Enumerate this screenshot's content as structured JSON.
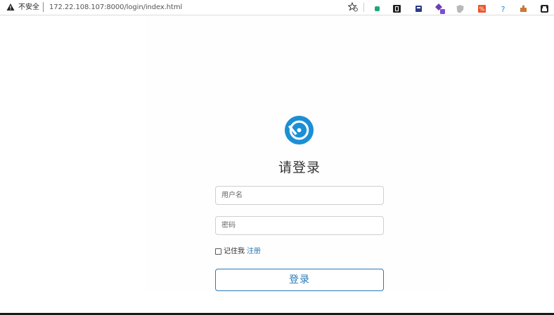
{
  "browser": {
    "security_label": "不安全",
    "url": "172.22.108.107:8000/login/index.html",
    "extension_icons": [
      {
        "name": "ext-green-icon",
        "color": "#1aa87a"
      },
      {
        "name": "ext-black-icon",
        "color": "#222222"
      },
      {
        "name": "ext-navy-icon",
        "color": "#2b3c8a"
      },
      {
        "name": "ext-purple-icon",
        "color": "#6a3fb5"
      },
      {
        "name": "ext-shield-icon",
        "color": "#b8b8b8"
      },
      {
        "name": "ext-orange-icon",
        "color": "#e8552a"
      },
      {
        "name": "ext-question-icon",
        "color": "#1f8ee8"
      },
      {
        "name": "ext-puzzle-icon",
        "color": "#c9783c"
      },
      {
        "name": "ext-profile-icon",
        "color": "#222222"
      }
    ]
  },
  "login": {
    "title": "请登录",
    "username_placeholder": "用户名",
    "password_placeholder": "密码",
    "remember_label": "记住我",
    "register_label": "注册",
    "submit_label": "登录"
  },
  "colors": {
    "accent": "#2a7ab8",
    "logo_blue": "#1b8fd6"
  }
}
